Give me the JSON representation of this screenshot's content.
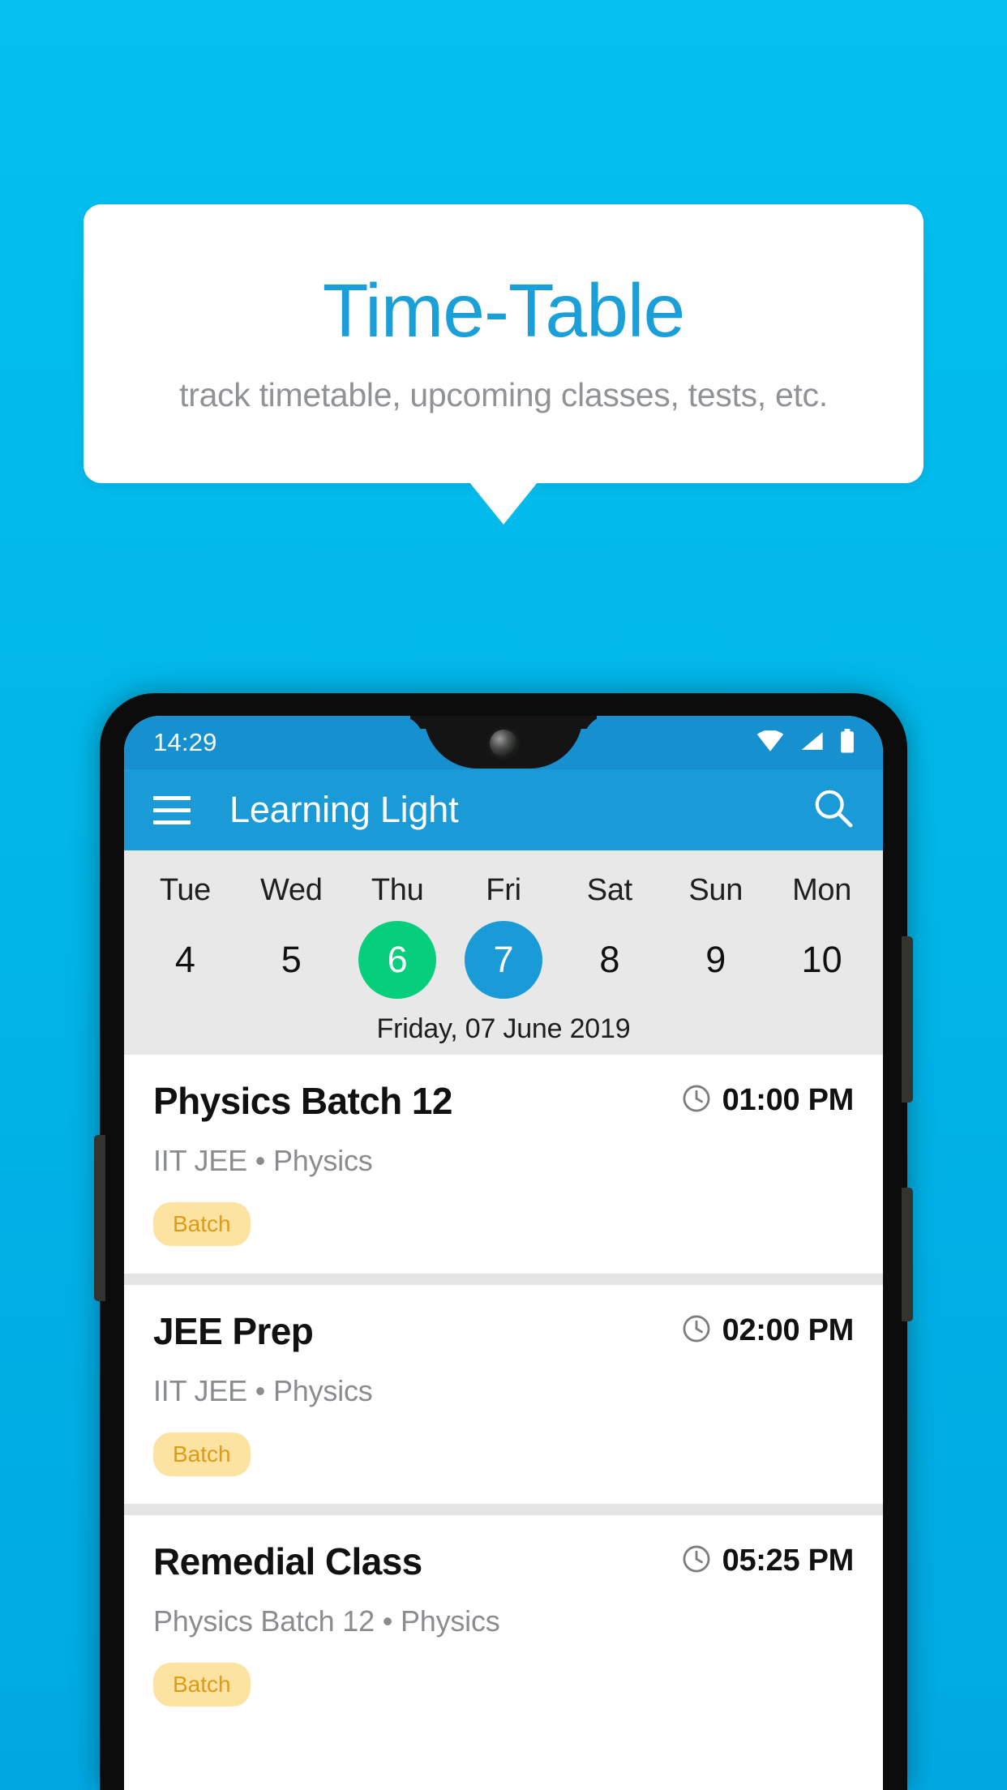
{
  "promo": {
    "title": "Time-Table",
    "subtitle": "track timetable, upcoming classes, tests, etc.",
    "title_color": "#1B9FD8",
    "subtitle_color": "#8f9396",
    "background_color": "#ffffff"
  },
  "background": {
    "gradient_top": "#03C0F0",
    "gradient_bottom": "#00A8E2"
  },
  "phone": {
    "status_bar": {
      "time": "14:29",
      "background_color": "#1790CF",
      "icons": [
        "wifi-icon",
        "cellular-signal-icon",
        "battery-icon"
      ]
    },
    "app_bar": {
      "menu_icon": "hamburger-menu-icon",
      "title": "Learning Light",
      "search_icon": "search-icon",
      "background_color": "#1A9AD7"
    },
    "date_strip": {
      "background_color": "#E8E8E8",
      "today_color": "#06CE7C",
      "selected_color": "#1A9AD7",
      "days": [
        {
          "name": "Tue",
          "number": "4",
          "state": "normal"
        },
        {
          "name": "Wed",
          "number": "5",
          "state": "normal"
        },
        {
          "name": "Thu",
          "number": "6",
          "state": "today"
        },
        {
          "name": "Fri",
          "number": "7",
          "state": "active"
        },
        {
          "name": "Sat",
          "number": "8",
          "state": "normal"
        },
        {
          "name": "Sun",
          "number": "9",
          "state": "normal"
        },
        {
          "name": "Mon",
          "number": "10",
          "state": "normal"
        }
      ],
      "selected_date_label": "Friday, 07 June 2019"
    },
    "class_list": {
      "badge_bg_color": "#FCE3A2",
      "badge_text_color": "#E09B16",
      "items": [
        {
          "title": "Physics Batch 12",
          "time": "01:00 PM",
          "subtitle": "IIT JEE • Physics",
          "badge": "Batch",
          "clock_icon": "clock-icon"
        },
        {
          "title": "JEE Prep",
          "time": "02:00 PM",
          "subtitle": "IIT JEE • Physics",
          "badge": "Batch",
          "clock_icon": "clock-icon"
        },
        {
          "title": "Remedial Class",
          "time": "05:25 PM",
          "subtitle": "Physics Batch 12 • Physics",
          "badge": "Batch",
          "clock_icon": "clock-icon"
        }
      ]
    }
  }
}
